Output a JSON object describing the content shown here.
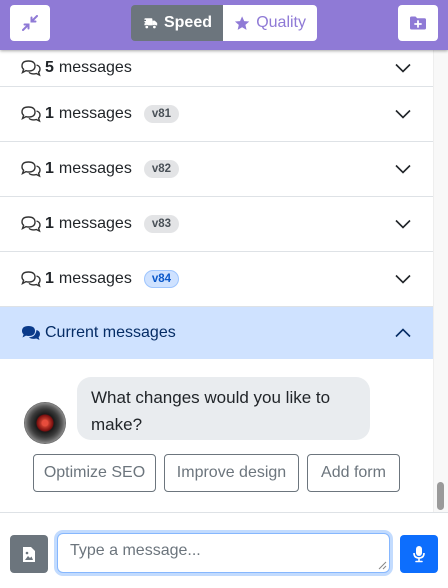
{
  "header": {
    "speed_label": "Speed",
    "quality_label": "Quality",
    "speed_icon": "truck-fast-icon",
    "quality_icon": "star-icon",
    "collapse_icon": "compress-icon",
    "new_icon": "folder-plus-icon",
    "colors": {
      "bar": "#8f7ad6",
      "speed_active": "#6c757d"
    }
  },
  "history": [
    {
      "count": "5",
      "label": "messages",
      "version": ""
    },
    {
      "count": "1",
      "label": "messages",
      "version": "v81"
    },
    {
      "count": "1",
      "label": "messages",
      "version": "v82"
    },
    {
      "count": "1",
      "label": "messages",
      "version": "v83"
    },
    {
      "count": "1",
      "label": "messages",
      "version": "v84",
      "active": true
    }
  ],
  "current_section": {
    "label": "Current messages",
    "expanded": true
  },
  "chat": {
    "assistant_message": "What changes would you like to make?",
    "avatar_icon": "hal-avatar-icon",
    "suggestions": [
      "Optimize SEO",
      "Improve design",
      "Add form"
    ]
  },
  "composer": {
    "placeholder": "Type a message...",
    "value": "",
    "attach_icon": "file-image-icon",
    "mic_icon": "microphone-icon"
  }
}
